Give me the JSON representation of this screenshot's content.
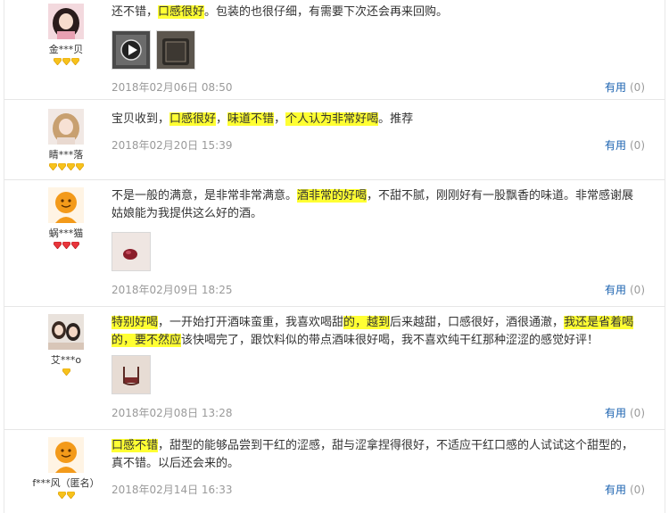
{
  "reviews": [
    {
      "user": "金***贝",
      "avatar": "avatar-girl-dark-hair",
      "rank_icon": "gold-diamond-icon",
      "rank_count": 3,
      "text": [
        "还不错，",
        "口感很好",
        "。包装的也很仔细，有需要下次还会再来回购。"
      ],
      "highlight": [
        false,
        true,
        false
      ],
      "photos": [
        "video-thumbnail",
        "wine-bottle-photo"
      ],
      "date": "2018年02月06日 08:50",
      "useful_label": "有用",
      "useful_count": "(0)"
    },
    {
      "user": "睛***落",
      "avatar": "avatar-girl-blonde",
      "rank_icon": "gold-diamond-icon",
      "rank_count": 4,
      "text": [
        "宝贝收到，",
        "口感很好",
        "，",
        "味道不错",
        "，",
        "个人认为非常好喝",
        "。推荐"
      ],
      "highlight": [
        false,
        true,
        false,
        true,
        false,
        true,
        false
      ],
      "photos": [],
      "date": "2018年02月20日 15:39",
      "useful_label": "有用",
      "useful_count": "(0)"
    },
    {
      "user": "蜗***猫",
      "avatar": "avatar-default-orange",
      "rank_icon": "red-heart-icon",
      "rank_count": 3,
      "text": [
        "不是一般的满意，是非常非常满意。",
        "酒非常的好喝",
        "，不甜不腻，刚刚好有一股飘香的味道。非常感谢展姑娘能为我提供这么好的酒。"
      ],
      "highlight": [
        false,
        true,
        false
      ],
      "photos": [
        "wine-glass-photo"
      ],
      "date": "2018年02月09日 18:25",
      "useful_label": "有用",
      "useful_count": "(0)"
    },
    {
      "user": "艾***o",
      "avatar": "avatar-two-girls",
      "rank_icon": "gold-diamond-icon",
      "rank_count": 1,
      "text": [
        "特别好喝",
        "，一开始打开酒味蛮重，我喜欢喝甜",
        "的，越到",
        "后来越甜，口感很好，酒很通澈，",
        "我还是省着喝的，要不然应",
        "该快喝完了，跟饮料似的带点酒味很好喝，我不喜欢纯干红那种涩涩的感觉好评！"
      ],
      "highlight": [
        true,
        false,
        true,
        false,
        true,
        false
      ],
      "photos": [
        "wine-cup-photo"
      ],
      "date": "2018年02月08日 13:28",
      "useful_label": "有用",
      "useful_count": "(0)"
    },
    {
      "user": "f***风（匿名）",
      "avatar": "avatar-default-orange",
      "rank_icon": "gold-diamond-icon",
      "rank_count": 2,
      "text": [
        "口感不错",
        "，甜型的能够品尝到干红的涩感，甜与涩拿捏得很好，不适应干红口感的人试试这个甜型的，真不错。以后还会来的。"
      ],
      "highlight": [
        true,
        false
      ],
      "photos": [],
      "date": "2018年02月14日 16:33",
      "useful_label": "有用",
      "useful_count": "(0)"
    }
  ]
}
